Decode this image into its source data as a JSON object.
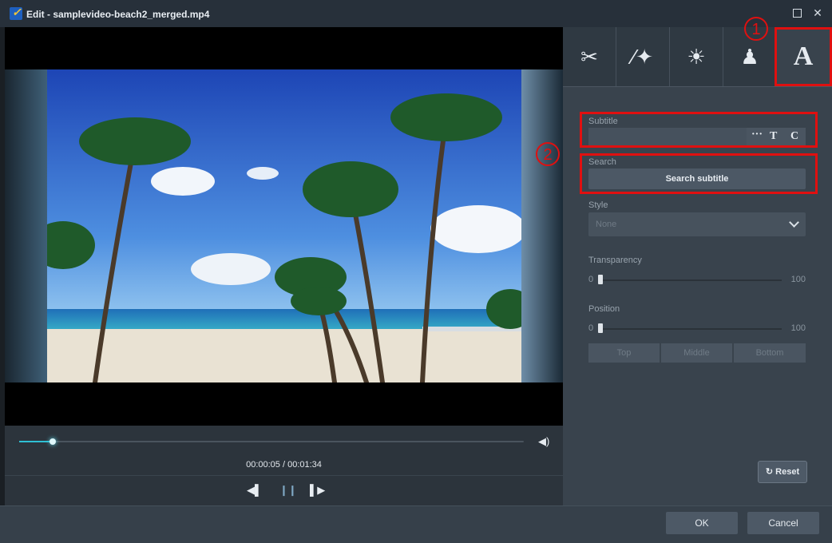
{
  "window": {
    "title": "Edit - samplevideo-beach2_merged.mp4",
    "icons": {
      "app": "app-logo-icon",
      "maximize": "maximize-icon",
      "close": "close-icon"
    }
  },
  "player": {
    "time_display": "00:00:05 / 00:01:34",
    "progress": 0.066,
    "icons": {
      "volume": "volume-icon",
      "prev": "previous-frame-icon",
      "pause": "pause-icon",
      "next": "next-frame-icon"
    }
  },
  "toolbar": {
    "tools": [
      {
        "name": "cut-tool",
        "icon": "scissors-icon",
        "glyph": "✂"
      },
      {
        "name": "effects-tool",
        "icon": "magic-wand-icon",
        "glyph": "⚚"
      },
      {
        "name": "brightness-tool",
        "icon": "brightness-icon",
        "glyph": "☀"
      },
      {
        "name": "watermark-tool",
        "icon": "stamp-icon",
        "glyph": "♟"
      },
      {
        "name": "text-tool",
        "icon": "text-icon",
        "glyph": "A"
      }
    ]
  },
  "subtitle": {
    "label": "Subtitle",
    "value": "",
    "more_label": "···",
    "t_label": "T",
    "c_label": "C"
  },
  "search": {
    "label": "Search",
    "button_label": "Search subtitle"
  },
  "style": {
    "label": "Style",
    "selected": "None"
  },
  "transparency": {
    "label": "Transparency",
    "min": "0",
    "max": "100",
    "value": 0
  },
  "position": {
    "label": "Position",
    "min": "0",
    "max": "100",
    "value": 0,
    "buttons": [
      "Top",
      "Middle",
      "Bottom"
    ]
  },
  "reset_label": "Reset",
  "footer": {
    "ok_label": "OK",
    "cancel_label": "Cancel"
  },
  "annotations": {
    "marker1": "1",
    "marker2": "2",
    "color": "#e01010"
  },
  "colors": {
    "accent": "#2fc0d4",
    "panel": "#39434d",
    "titlebar": "#27303a"
  }
}
